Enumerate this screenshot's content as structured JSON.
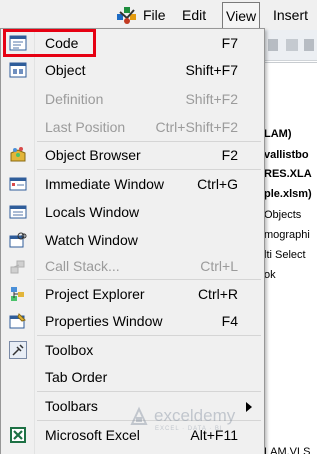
{
  "menubar": {
    "file": "File",
    "edit": "Edit",
    "view": "View",
    "insert": "Insert"
  },
  "background_lines": [
    "LAM)",
    "vallistbo",
    "RES.XLA",
    "ple.xlsm)",
    "Objects",
    "mographi",
    "lti Select",
    "ok",
    "LAM.VLS"
  ],
  "menu": {
    "items": [
      {
        "label": "Code",
        "shortcut": "F7",
        "icon": "code-window-icon",
        "enabled": true
      },
      {
        "label": "Object",
        "shortcut": "Shift+F7",
        "icon": "object-icon",
        "enabled": true
      },
      {
        "label": "Definition",
        "shortcut": "Shift+F2",
        "icon": "",
        "enabled": false
      },
      {
        "label": "Last Position",
        "shortcut": "Ctrl+Shift+F2",
        "icon": "",
        "enabled": false
      },
      {
        "label": "Object Browser",
        "shortcut": "F2",
        "icon": "object-browser-icon",
        "enabled": true
      },
      {
        "label": "Immediate Window",
        "shortcut": "Ctrl+G",
        "icon": "immediate-window-icon",
        "enabled": true
      },
      {
        "label": "Locals Window",
        "shortcut": "",
        "icon": "locals-window-icon",
        "enabled": true
      },
      {
        "label": "Watch Window",
        "shortcut": "",
        "icon": "watch-window-icon",
        "enabled": true
      },
      {
        "label": "Call Stack...",
        "shortcut": "Ctrl+L",
        "icon": "call-stack-icon",
        "enabled": false
      },
      {
        "label": "Project Explorer",
        "shortcut": "Ctrl+R",
        "icon": "project-explorer-icon",
        "enabled": true
      },
      {
        "label": "Properties Window",
        "shortcut": "F4",
        "icon": "properties-window-icon",
        "enabled": true
      },
      {
        "label": "Toolbox",
        "shortcut": "",
        "icon": "toolbox-icon",
        "enabled": true
      },
      {
        "label": "Tab Order",
        "shortcut": "",
        "icon": "",
        "enabled": true
      },
      {
        "label": "Toolbars",
        "shortcut": "",
        "icon": "",
        "enabled": true
      },
      {
        "label": "Microsoft Excel",
        "shortcut": "Alt+F11",
        "icon": "excel-icon",
        "enabled": true
      }
    ]
  },
  "watermark": {
    "name": "exceldemy",
    "sub": "EXCEL · DATA · BI"
  },
  "colors": {
    "highlight": "#e60012",
    "menu_bg": "#f0f0f0",
    "disabled_text": "#9b9b9b"
  }
}
